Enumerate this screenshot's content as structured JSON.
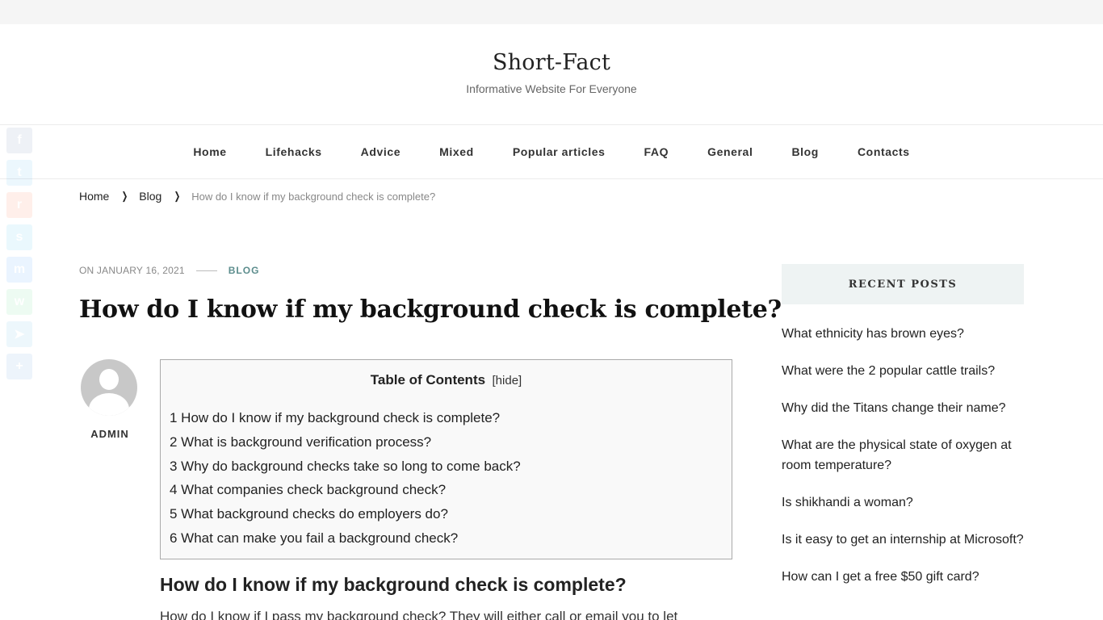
{
  "site": {
    "title": "Short-Fact",
    "tagline": "Informative Website For Everyone"
  },
  "nav": {
    "items": [
      "Home",
      "Lifehacks",
      "Advice",
      "Mixed",
      "Popular articles",
      "FAQ",
      "General",
      "Blog",
      "Contacts"
    ]
  },
  "breadcrumb": {
    "home": "Home",
    "blog": "Blog",
    "current": "How do I know if my background check is complete?"
  },
  "social": {
    "icons": [
      "facebook-icon",
      "twitter-icon",
      "reddit-icon",
      "skype-icon",
      "messenger-icon",
      "whatsapp-icon",
      "telegram-icon",
      "share-icon"
    ],
    "colors": [
      "#3b5998",
      "#1da1f2",
      "#ff4500",
      "#00aff0",
      "#0084ff",
      "#25d366",
      "#2ca5e0",
      "#2a7fd4"
    ]
  },
  "post": {
    "date": "ON JANUARY 16, 2021",
    "category": "BLOG",
    "title": "How do I know if my background check is complete?",
    "author": "ADMIN",
    "section_heading": "How do I know if my background check is complete?",
    "body_start": "How do I know if I pass my background check? They will either call or email you to let"
  },
  "toc": {
    "title": "Table of Contents",
    "toggle": "[hide]",
    "items": [
      "1 How do I know if my background check is complete?",
      "2 What is background verification process?",
      "3 Why do background checks take so long to come back?",
      "4 What companies check background check?",
      "5 What background checks do employers do?",
      "6 What can make you fail a background check?"
    ]
  },
  "sidebar": {
    "widget_title": "RECENT POSTS",
    "recent_posts": [
      "What ethnicity has brown eyes?",
      "What were the 2 popular cattle trails?",
      "Why did the Titans change their name?",
      "What are the physical state of oxygen at room temperature?",
      "Is shikhandi a woman?",
      "Is it easy to get an internship at Microsoft?",
      "How can I get a free $50 gift card?"
    ]
  },
  "colors": {
    "accent": "#5c8d8d",
    "widget_bg": "#eef3f3"
  }
}
